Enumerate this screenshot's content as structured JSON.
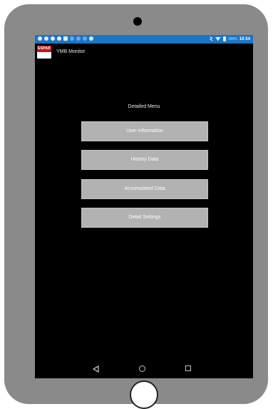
{
  "status_bar": {
    "battery": "100%",
    "time": "18:54"
  },
  "app_bar": {
    "logo_text": "ESPAR",
    "title": "YMB Monitor"
  },
  "menu": {
    "title": "Detailed Menu",
    "items": [
      {
        "label": "User Information"
      },
      {
        "label": "History Data"
      },
      {
        "label": "Accumulated Data"
      },
      {
        "label": "Detail Settings"
      }
    ]
  },
  "nav_icons": [
    "back-icon",
    "home-icon",
    "recent-apps-icon"
  ],
  "colors": {
    "status_bar": "#1976c9",
    "screen_background": "#000000",
    "button_fill": "#b2b2b2",
    "device_frame": "#8a8a8a",
    "logo_red": "#c4161c"
  }
}
